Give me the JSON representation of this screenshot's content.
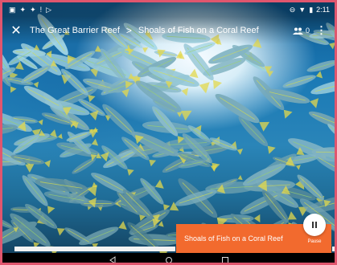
{
  "status_bar": {
    "time": "2:11",
    "icons_left": [
      "image-icon",
      "app-icon",
      "app-icon",
      "exclamation-icon",
      "play-store-icon"
    ],
    "icons_right": [
      "no-disturb-icon",
      "wifi-icon",
      "battery-icon"
    ]
  },
  "app_bar": {
    "breadcrumb_parent": "The Great Barrier Reef",
    "breadcrumb_separator": ">",
    "breadcrumb_current": "Shoals of Fish on a Coral Reef",
    "viewer_count": "0",
    "close_icon": "close-icon",
    "more_icon": "more-vert-icon"
  },
  "player": {
    "now_playing_title": "Shoals of Fish on a Coral Reef",
    "pause_label": "Pause",
    "bar_color": "#f26a2e"
  },
  "nav_bar": {
    "back": "back-icon",
    "home": "home-icon",
    "recents": "recents-icon"
  }
}
